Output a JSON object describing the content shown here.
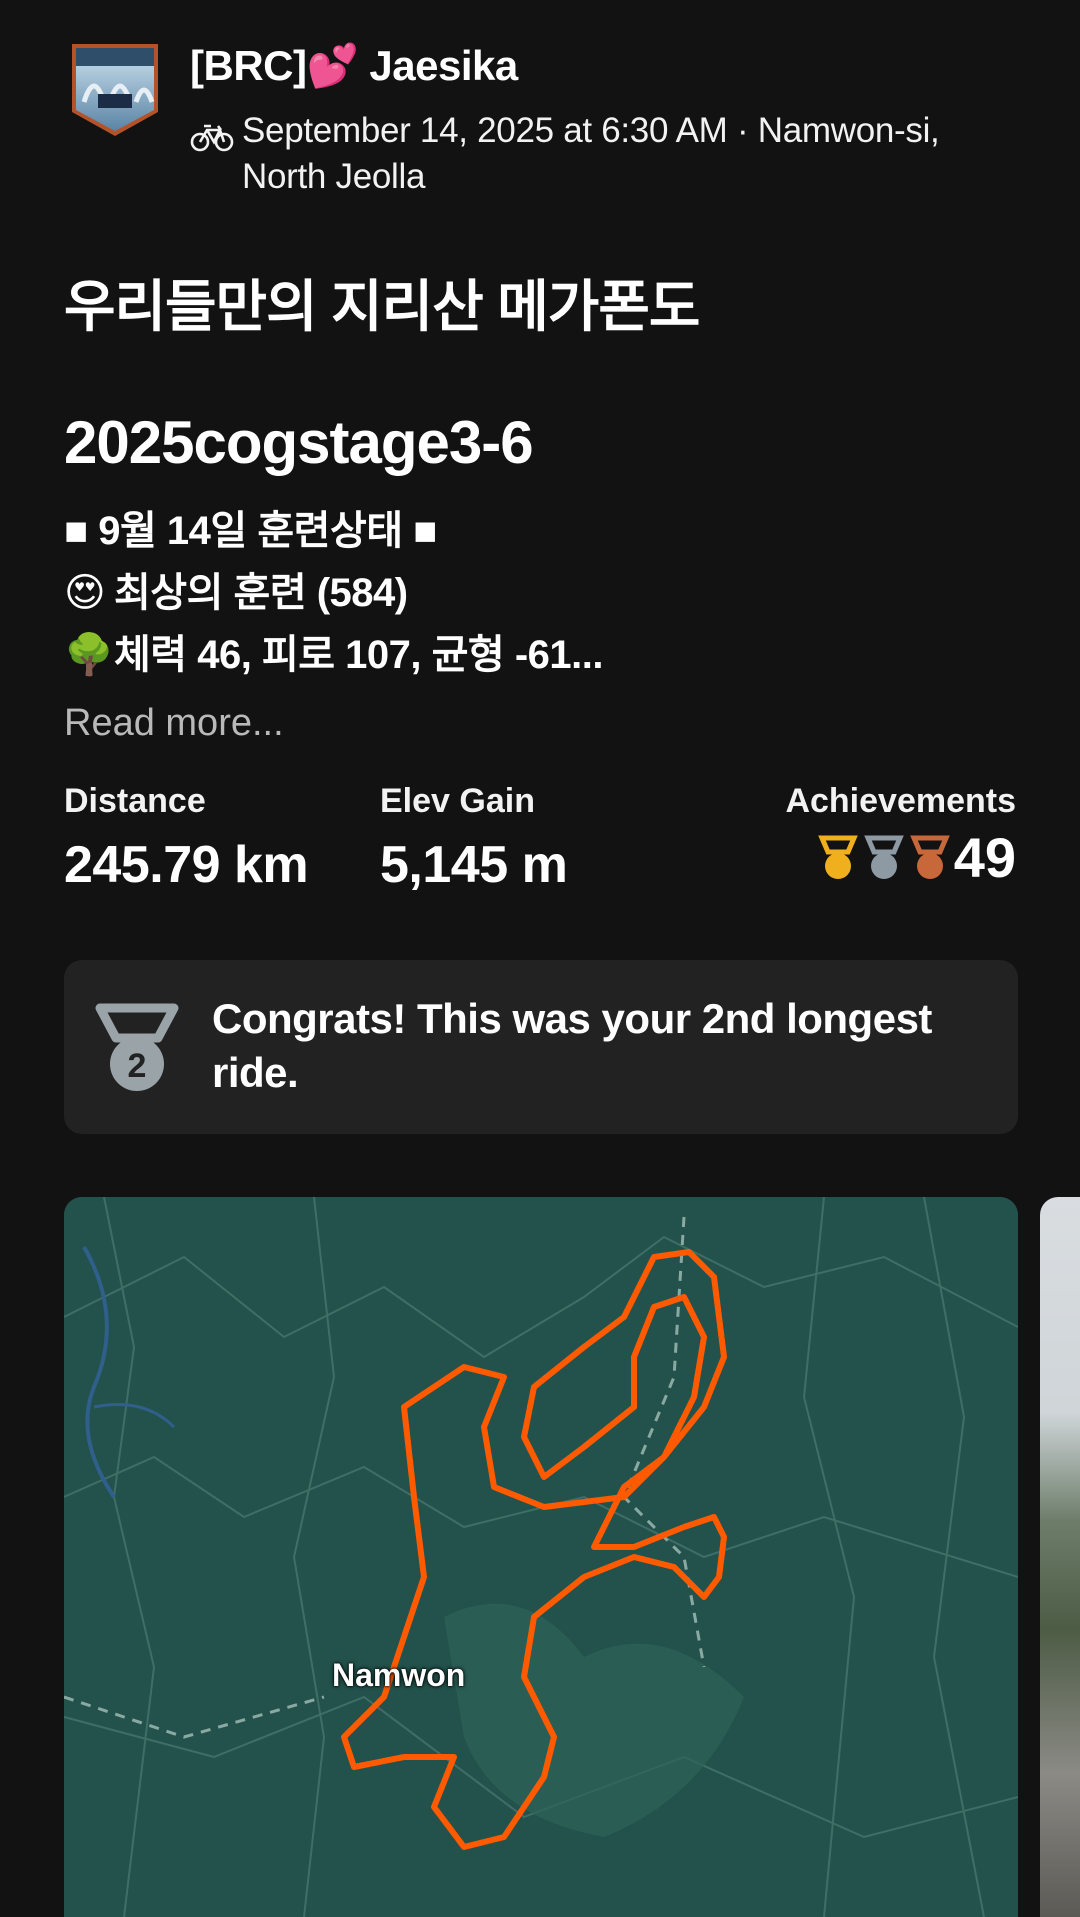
{
  "header": {
    "athlete_name_prefix": "[BRC]",
    "athlete_name_heart": "💕",
    "athlete_name_suffix": " Jaesika",
    "activity_icon": "bike-icon",
    "meta": "September 14, 2025 at 6:30 AM · Namwon-si, North Jeolla"
  },
  "activity": {
    "title": "우리들만의 지리산 메가폰도",
    "subtitle": "2025cogstage3-6",
    "description_lines": [
      {
        "emoji": "",
        "text": "■ 9월 14일 훈련상태 ■"
      },
      {
        "emoji": "😍",
        "text": "최상의 훈련 (584)"
      },
      {
        "emoji": "🌳",
        "text": "체력 46, 피로 107, 균형 -61..."
      }
    ],
    "read_more": "Read more..."
  },
  "stats": {
    "distance_label": "Distance",
    "distance_value": "245.79 km",
    "elev_label": "Elev Gain",
    "elev_value": "5,145 m",
    "achievements_label": "Achievements",
    "achievements_count": "49",
    "medal_colors": [
      "#f0b01e",
      "#8e9aa3",
      "#c8683a"
    ]
  },
  "congrats": {
    "icon": "silver-medal-2-icon",
    "medal_number": "2",
    "text": "Congrats! This was your 2nd longest ride."
  },
  "map": {
    "place_label": "Namwon",
    "route_color": "#ff5a00"
  }
}
